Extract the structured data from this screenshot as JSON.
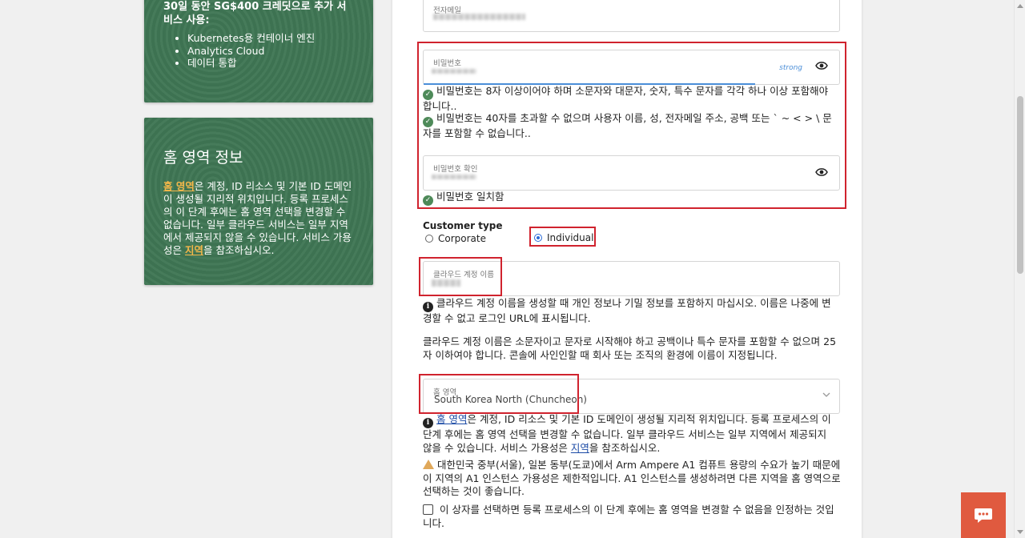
{
  "promo": {
    "title": "30일 동안 SG$400 크레딧으로 추가 서비스 사용:",
    "items": [
      "Kubernetes용 컨테이너 엔진",
      "Analytics Cloud",
      "데이터 통합"
    ]
  },
  "home_region_info": {
    "heading": "홈 영역 정보",
    "link1": "홈 영역",
    "text1": "은 계정, ID 리소스 및 기본 ID 도메인이 생성될 지리적 위치입니다. 등록 프로세스의 이 단계 후에는 홈 영역 선택을 변경할 수 없습니다. 일부 클라우드 서비스는 일부 지역에서 제공되지 않을 수 있습니다. 서비스 가용성은 ",
    "link2": "지역",
    "text2": "을 참조하십시오."
  },
  "form": {
    "email_label": "전자메일",
    "password_label": "비밀번호",
    "strength": "strong",
    "pw_rule1": "비밀번호는 8자 이상이어야 하며 소문자와 대문자, 숫자, 특수 문자를 각각 하나 이상 포함해야 합니다..",
    "pw_rule2": "비밀번호는 40자를 초과할 수 없으며 사용자 이름, 성, 전자메일 주소, 공백 또는 ` ~ < > \\ 문자를 포함할 수 없습니다..",
    "confirm_label": "비밀번호 확인",
    "match_msg": "비밀번호 일치함",
    "customer_type_label": "Customer type",
    "customer_types": [
      "Corporate",
      "Individual"
    ],
    "selected_customer_type": "Individual",
    "cloud_account_label": "클라우드 계정 이름",
    "cloud_hint1": "클라우드 계정 이름을 생성할 때 개인 정보나 기밀 정보를 포함하지 마십시오. 이름은 나중에 변경할 수 없고 로그인 URL에 표시됩니다.",
    "cloud_hint2": "클라우드 계정 이름은 소문자이고 문자로 시작해야 하고 공백이나 특수 문자를 포함할 수 없으며 25자 이하여야 합니다. 콘솔에 사인인할 때 회사 또는 조직의 환경에 이름이 지정됩니다.",
    "home_region_label": "홈 영역",
    "home_region_value": "South Korea North (Chuncheon)",
    "region_info_link1": "홈 영역",
    "region_info_text1": "은 계정, ID 리소스 및 기본 ID 도메인이 생성될 지리적 위치입니다. 등록 프로세스의 이 단계 후에는 홈 영역 선택을 변경할 수 없습니다. 일부 클라우드 서비스는 일부 지역에서 제공되지 않을 수 있습니다. 서비스 가용성은 ",
    "region_info_link2": "지역",
    "region_info_text2": "을 참조하십시오.",
    "warning": "대한민국 중부(서울), 일본 동부(도쿄)에서 Arm Ampere A1 컴퓨트 용량의 수요가 높기 때문에 이 지역의 A1 인스턴스 가용성은 제한적입니다. A1 인스턴스를 생성하려면 다른 지역을 홈 영역으로 선택하는 것이 좋습니다.",
    "ack_checkbox": "이 상자를 선택하면 등록 프로세스의 이 단계 후에는 홈 영역을 변경할 수 없음을 인정하는 것입니다."
  },
  "colors": {
    "panel_green": "#3f7654",
    "highlight_red": "#d0232e",
    "link_blue": "#1b4aa5",
    "chat_orange": "#e05a3f"
  },
  "icons": [
    "check-circle-icon",
    "eye-icon",
    "info-icon",
    "warning-icon",
    "chevron-down-icon",
    "chat-icon"
  ]
}
